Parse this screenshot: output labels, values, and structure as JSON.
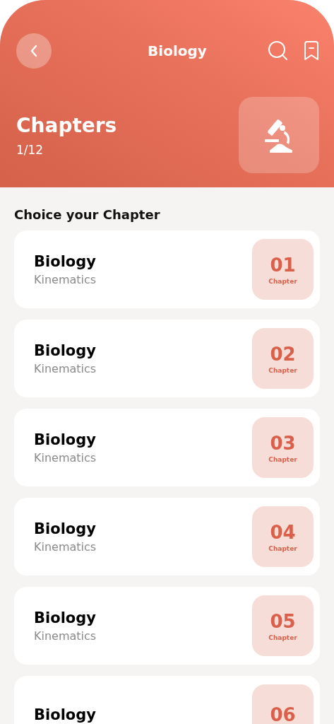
{
  "header": {
    "title": "Biology",
    "section_title": "Chapters",
    "progress": "1/12"
  },
  "list_heading": "Choice your Chapter",
  "chapters": [
    {
      "title": "Biology",
      "subtitle": "Kinematics",
      "number": "01",
      "number_label": "Chapter"
    },
    {
      "title": "Biology",
      "subtitle": "Kinematics",
      "number": "02",
      "number_label": "Chapter"
    },
    {
      "title": "Biology",
      "subtitle": "Kinematics",
      "number": "03",
      "number_label": "Chapter"
    },
    {
      "title": "Biology",
      "subtitle": "Kinematics",
      "number": "04",
      "number_label": "Chapter"
    },
    {
      "title": "Biology",
      "subtitle": "Kinematics",
      "number": "05",
      "number_label": "Chapter"
    },
    {
      "title": "Biology",
      "number": "06"
    }
  ]
}
